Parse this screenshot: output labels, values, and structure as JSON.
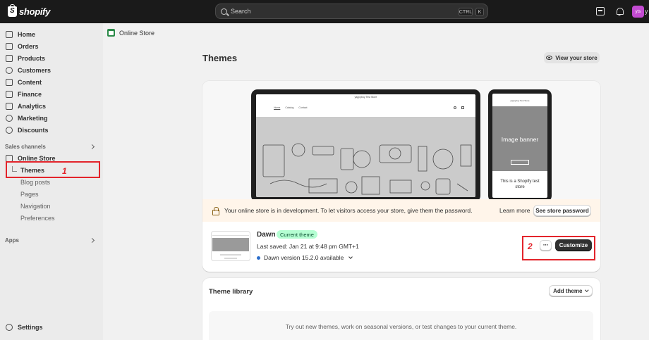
{
  "topbar": {
    "logo_text": "shopify",
    "search_placeholder": "Search",
    "shortcut_ctrl": "CTRL",
    "shortcut_k": "K",
    "avatar_initials": "yts",
    "avatar_tail": "y"
  },
  "sidebar": {
    "items": [
      {
        "label": "Home",
        "icon": "home-icon"
      },
      {
        "label": "Orders",
        "icon": "orders-icon"
      },
      {
        "label": "Products",
        "icon": "products-icon"
      },
      {
        "label": "Customers",
        "icon": "customers-icon"
      },
      {
        "label": "Content",
        "icon": "content-icon"
      },
      {
        "label": "Finance",
        "icon": "finance-icon"
      },
      {
        "label": "Analytics",
        "icon": "analytics-icon"
      },
      {
        "label": "Marketing",
        "icon": "marketing-icon"
      },
      {
        "label": "Discounts",
        "icon": "discounts-icon"
      }
    ],
    "sales_channels_label": "Sales channels",
    "online_store_label": "Online Store",
    "sub_items": [
      "Themes",
      "Blog posts",
      "Pages",
      "Navigation",
      "Preferences"
    ],
    "apps_label": "Apps",
    "settings_label": "Settings"
  },
  "annotations": {
    "one": "1",
    "two": "2",
    "color": "#e3242b"
  },
  "breadcrumb": {
    "label": "Online Store"
  },
  "page": {
    "title": "Themes",
    "view_store_label": "View your store"
  },
  "preview": {
    "laptop_store_name": "yappyboy Test Store",
    "laptop_nav": [
      "Home",
      "Catalog",
      "Contact"
    ],
    "phone_store_name": "yappyboy Test Store",
    "phone_banner": "Image banner",
    "phone_text": "This is a Shopify test store"
  },
  "dev_banner": {
    "message": "Your online store is in development. To let visitors access your store, give them the password.",
    "learn_more": "Learn more",
    "see_password": "See store password"
  },
  "current_theme": {
    "name": "Dawn",
    "badge": "Current theme",
    "last_saved": "Last saved: Jan 21 at 9:48 pm GMT+1",
    "version": "Dawn version 15.2.0 available",
    "more_label": "···",
    "customize_label": "Customize"
  },
  "library": {
    "title": "Theme library",
    "add_theme_label": "Add theme",
    "empty_text": "Try out new themes, work on seasonal versions, or test changes to your current theme."
  },
  "colors": {
    "topbar_bg": "#1a1a1a",
    "sidebar_bg": "#ebebeb",
    "main_bg": "#f1f1f1",
    "badge_bg": "#b4fed2",
    "banner_bg": "#fff5ea",
    "primary_button": "#303030"
  }
}
